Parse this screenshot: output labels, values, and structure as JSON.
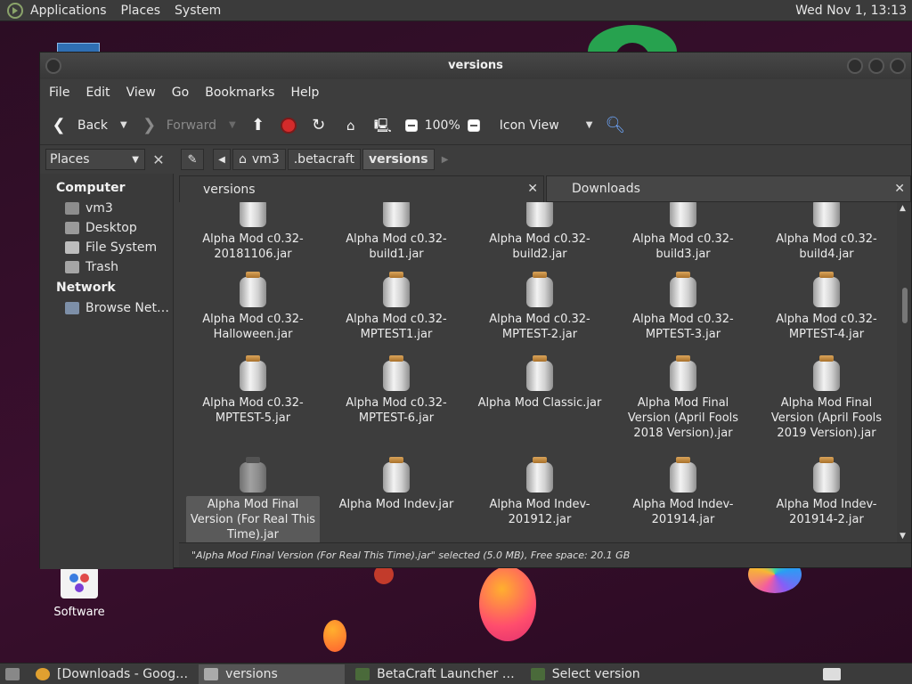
{
  "top_panel": {
    "menus": [
      "Applications",
      "Places",
      "System"
    ],
    "clock": "Wed Nov 1, 13:13"
  },
  "desktop": {
    "software_label": "Software"
  },
  "window": {
    "title": "versions",
    "menubar": [
      "File",
      "Edit",
      "View",
      "Go",
      "Bookmarks",
      "Help"
    ],
    "toolbar": {
      "back": "Back",
      "forward": "Forward",
      "zoom": "100%",
      "view_mode": "Icon View"
    },
    "location": {
      "places_label": "Places",
      "crumbs": [
        "vm3",
        ".betacraft",
        "versions"
      ]
    },
    "sidebar": {
      "computer_heading": "Computer",
      "computer_items": [
        "vm3",
        "Desktop",
        "File System",
        "Trash"
      ],
      "network_heading": "Network",
      "network_items": [
        "Browse Net…"
      ]
    },
    "tabs": [
      {
        "label": "versions"
      },
      {
        "label": "Downloads"
      }
    ],
    "files": [
      "Alpha Mod c0.32-\n20181106.jar",
      "Alpha Mod c0.32-\nbuild1.jar",
      "Alpha Mod c0.32-\nbuild2.jar",
      "Alpha Mod c0.32-\nbuild3.jar",
      "Alpha Mod c0.32-\nbuild4.jar",
      "Alpha Mod c0.32-\nHalloween.jar",
      "Alpha Mod c0.32-\nMPTEST1.jar",
      "Alpha Mod c0.32-\nMPTEST-2.jar",
      "Alpha Mod c0.32-\nMPTEST-3.jar",
      "Alpha Mod c0.32-\nMPTEST-4.jar",
      "Alpha Mod c0.32-\nMPTEST-5.jar",
      "Alpha Mod c0.32-\nMPTEST-6.jar",
      "Alpha Mod Classic.jar",
      "Alpha Mod Final\nVersion (April Fools\n2018 Version).jar",
      "Alpha Mod Final\nVersion (April Fools\n2019 Version).jar",
      "Alpha Mod Final\nVersion (For Real This\nTime).jar",
      "Alpha Mod Indev.jar",
      "Alpha Mod Indev-\n201912.jar",
      "Alpha Mod Indev-\n201914.jar",
      "Alpha Mod Indev-\n201914-2.jar"
    ],
    "status": "\"Alpha Mod Final Version (For Real This Time).jar\" selected (5.0 MB), Free space: 20.1 GB"
  },
  "taskbar": {
    "tasks": [
      "[Downloads - Goog…",
      "versions",
      "BetaCraft Launcher …",
      "Select version"
    ]
  }
}
